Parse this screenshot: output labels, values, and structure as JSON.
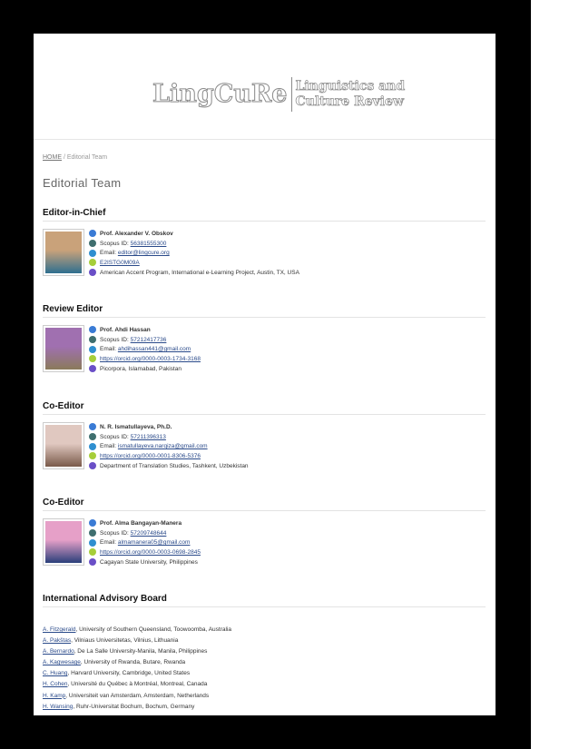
{
  "header": {
    "logo_mark": "LingCuRe",
    "logo_line1": "Linguistics and",
    "logo_line2": "Culture Review"
  },
  "breadcrumb": {
    "home": "HOME",
    "sep": "/",
    "current": "Editorial Team"
  },
  "page_title": "Editorial Team",
  "sections": [
    {
      "title": "Editor-in-Chief",
      "name": "Prof. Alexander V. Obskov",
      "scopus_label": "Scopus ID:",
      "scopus": "56381555300",
      "email_label": "Email:",
      "email": "editor@lingcure.org",
      "orcid": "E2ISTG0M09A",
      "affiliation": "American Accent Program, International e-Learning Project, Austin, TX, USA",
      "photo_colors": [
        "#2f6f8f",
        "#c9a27a"
      ]
    },
    {
      "title": "Review Editor",
      "name": "Prof. Ahdi Hassan",
      "scopus_label": "Scopus ID:",
      "scopus": "57212417736",
      "email_label": "Email:",
      "email": "ahdihassan441@gmail.com",
      "orcid": "https://orcid.org/0000-0003-1734-3168",
      "affiliation": "Picorpora, Islamabad, Pakistan",
      "photo_colors": [
        "#8a7a5a",
        "#a070b0"
      ]
    },
    {
      "title": "Co-Editor",
      "name": "N. R. Ismatullayeva, Ph.D.",
      "scopus_label": "Scopus ID:",
      "scopus": "57211396313",
      "email_label": "Email:",
      "email": "ismatullayeva.narqiza@gmail.com",
      "orcid": "https://orcid.org/0000-0001-8306-5376",
      "affiliation": "Department of Translation Studies, Tashkent, Uzbekistan",
      "photo_colors": [
        "#7a5a4a",
        "#e0c8c0"
      ]
    },
    {
      "title": "Co-Editor",
      "name": "Prof. Alma Bangayan-Manera",
      "scopus_label": "Scopus ID:",
      "scopus": "57209748644",
      "email_label": "Email:",
      "email": "almamanera05@gmail.com",
      "orcid": "https://orcid.org/0000-0003-0698-2845",
      "affiliation": "Cagayan State University, Philippines",
      "photo_colors": [
        "#2a3f7a",
        "#e6a0c8"
      ]
    }
  ],
  "board": {
    "title": "International Advisory Board",
    "items": [
      {
        "name": "A. Fitzgerald",
        "rest": ", University of Southern Queensland, Toowoomba, Australia"
      },
      {
        "name": "A. Pakštas",
        "rest": ", Vilniaus Universitetas, Vilnius, Lithuania"
      },
      {
        "name": "A. Bernardo",
        "rest": ", De La Salle University-Manila, Manila, Philippines"
      },
      {
        "name": "A. Kagwesage",
        "rest": ", University of Rwanda, Butare, Rwanda"
      },
      {
        "name": "C. Huang",
        "rest": ", Harvard University, Cambridge, United States"
      },
      {
        "name": "H. Cohen",
        "rest": ", Université du Québec à Montréal, Montreal, Canada"
      },
      {
        "name": "H. Kamp",
        "rest": ", Universiteit van Amsterdam, Amsterdam, Netherlands"
      },
      {
        "name": "H. Wansing",
        "rest": ", Ruhr-Universitat Bochum, Bochum, Germany"
      }
    ]
  },
  "icons": [
    "user-icon",
    "scopus-icon",
    "email-icon",
    "orcid-icon",
    "location-icon"
  ]
}
